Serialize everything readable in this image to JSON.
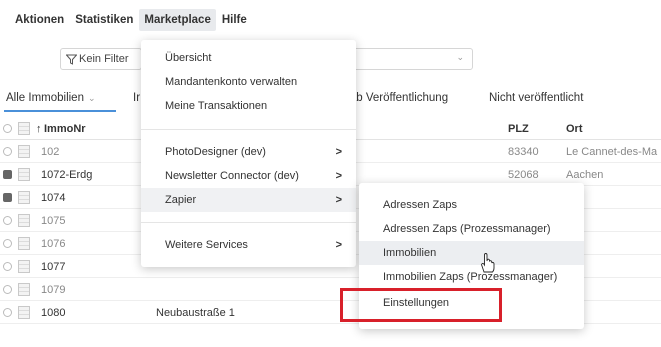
{
  "menubar": {
    "items": [
      {
        "label": "Aktionen"
      },
      {
        "label": "Statistiken"
      },
      {
        "label": "Marketplace"
      },
      {
        "label": "Hilfe"
      }
    ]
  },
  "filter": {
    "label": "Kein Filter"
  },
  "tabs": [
    {
      "label": "Alle Immobilien"
    },
    {
      "label": "Ir"
    },
    {
      "label": "rab Veröffentlichung"
    },
    {
      "label": "Nicht veröffentlicht"
    }
  ],
  "table": {
    "headers": {
      "nr": "ImmoNr",
      "plz": "PLZ",
      "ort": "Ort"
    },
    "rows": [
      {
        "nr": "102",
        "street": "",
        "plz": "83340",
        "ort": "Le Cannet-des-Ma"
      },
      {
        "nr": "1072-Erdg",
        "street": "",
        "plz": "52068",
        "ort": "Aachen"
      },
      {
        "nr": "1074",
        "street": "",
        "plz": "",
        "ort": ""
      },
      {
        "nr": "1075",
        "street": "",
        "plz": "",
        "ort": ""
      },
      {
        "nr": "1076",
        "street": "",
        "plz": "",
        "ort": ""
      },
      {
        "nr": "1077",
        "street": "",
        "plz": "",
        "ort": ""
      },
      {
        "nr": "1079",
        "street": "",
        "plz": "",
        "ort": ""
      },
      {
        "nr": "1080",
        "street": "Neubaustraße 1",
        "plz": "",
        "ort": ""
      }
    ]
  },
  "marketplace_menu": {
    "items": [
      {
        "label": "Übersicht"
      },
      {
        "label": "Mandantenkonto verwalten"
      },
      {
        "label": "Meine Transaktionen"
      },
      {
        "label": "PhotoDesigner (dev)",
        "arrow": ">"
      },
      {
        "label": "Newsletter Connector (dev)",
        "arrow": ">"
      },
      {
        "label": "Zapier",
        "arrow": ">"
      },
      {
        "label": "Weitere Services",
        "arrow": ">"
      }
    ]
  },
  "zapier_submenu": {
    "items": [
      {
        "label": "Adressen Zaps"
      },
      {
        "label": "Adressen Zaps (Prozessmanager)"
      },
      {
        "label": "Immobilien"
      },
      {
        "label": "Immobilien Zaps (Prozessmanager)"
      },
      {
        "label": "Einstellungen"
      }
    ]
  },
  "colors": {
    "highlight": "#d8202a",
    "tab_underline": "#4a90d9"
  }
}
